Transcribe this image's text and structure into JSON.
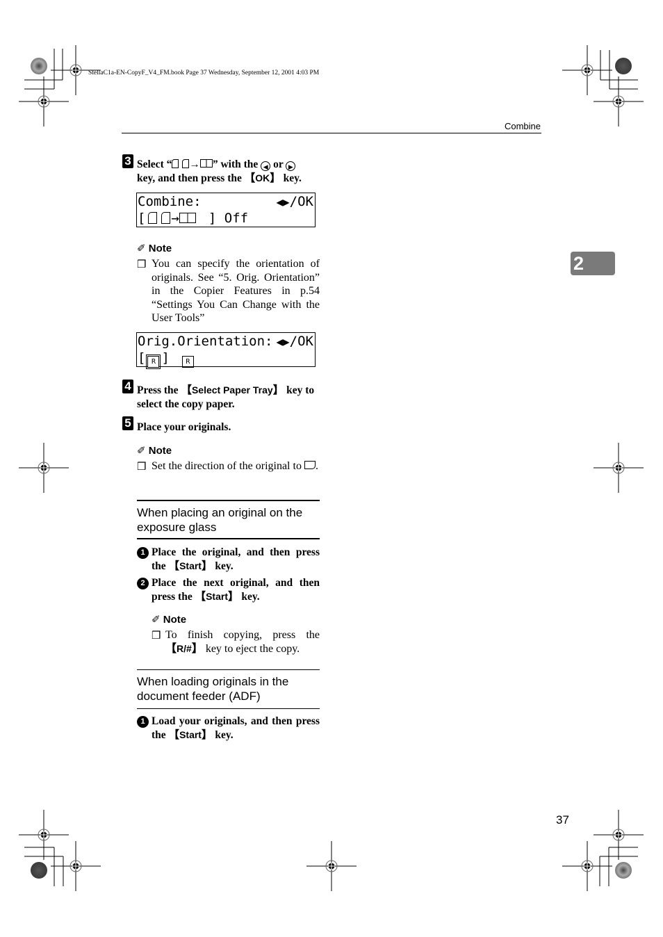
{
  "file_header": "StellaC1a-EN-CopyF_V4_FM.book  Page 37  Wednesday, September 12, 2001  4:03 PM",
  "running_head": "Combine",
  "chapter_tab": "2",
  "page_number": "37",
  "step3": {
    "number": "3",
    "line1_a": "Select “",
    "line1_b": "” with the ",
    "line1_c": " or ",
    "line2_a": "key, and then press the ",
    "key": "OK",
    "line2_b": " key.",
    "icons": [
      "portrait-page-icon",
      "portrait-page-icon",
      "arrow-right-icon",
      "two-up-page-icon",
      "left-arrow-key-icon",
      "right-arrow-key-icon"
    ]
  },
  "lcd1": {
    "line1_left": "Combine:",
    "line1_right": "/OK",
    "line2_left": "[",
    "line2_right": "] Off"
  },
  "note1": {
    "title": "Note",
    "body": "You can specify the orientation of originals. See “5. Orig. Orientation” in the Copier Features in p.54 “Settings You Can Change with the User Tools”"
  },
  "lcd2": {
    "line1_left": "Orig.Orientation:",
    "line1_right": "/OK",
    "line2_left": "[",
    "line2_mid": "]"
  },
  "step4": {
    "number": "4",
    "text_a": "Press the ",
    "key": "Select Paper Tray",
    "text_b": " key to select the copy paper."
  },
  "step5": {
    "number": "5",
    "text": "Place your originals."
  },
  "note2": {
    "title": "Note",
    "body": "Set the direction of the original to",
    "body_end": "."
  },
  "section_glass": {
    "heading": "When placing an original on the exposure glass",
    "steps": [
      {
        "num": "1",
        "text_a": "Place the original, and then press the ",
        "key": "Start",
        "text_b": " key."
      },
      {
        "num": "2",
        "text_a": "Place the next original, and then press the ",
        "key": "Start",
        "text_b": " key."
      }
    ]
  },
  "note3": {
    "title": "Note",
    "body_a": "To finish copying, press the ",
    "key": "R/#",
    "body_b": " key to eject the copy."
  },
  "section_adf": {
    "heading": "When loading originals in the document feeder (ADF)",
    "steps": [
      {
        "num": "1",
        "text_a": "Load your originals, and then press the ",
        "key": "Start",
        "text_b": " key."
      }
    ]
  }
}
